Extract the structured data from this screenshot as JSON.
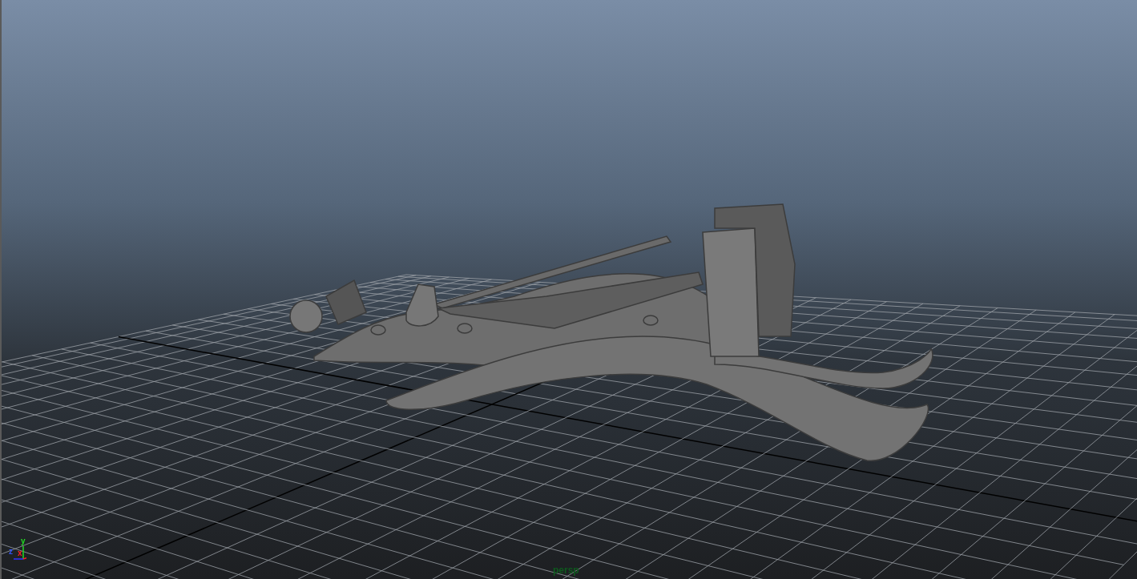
{
  "viewport": {
    "camera_label": "persp"
  },
  "axis_gizmo": {
    "y_label": "y",
    "z_label": "z",
    "x_label": "x"
  }
}
